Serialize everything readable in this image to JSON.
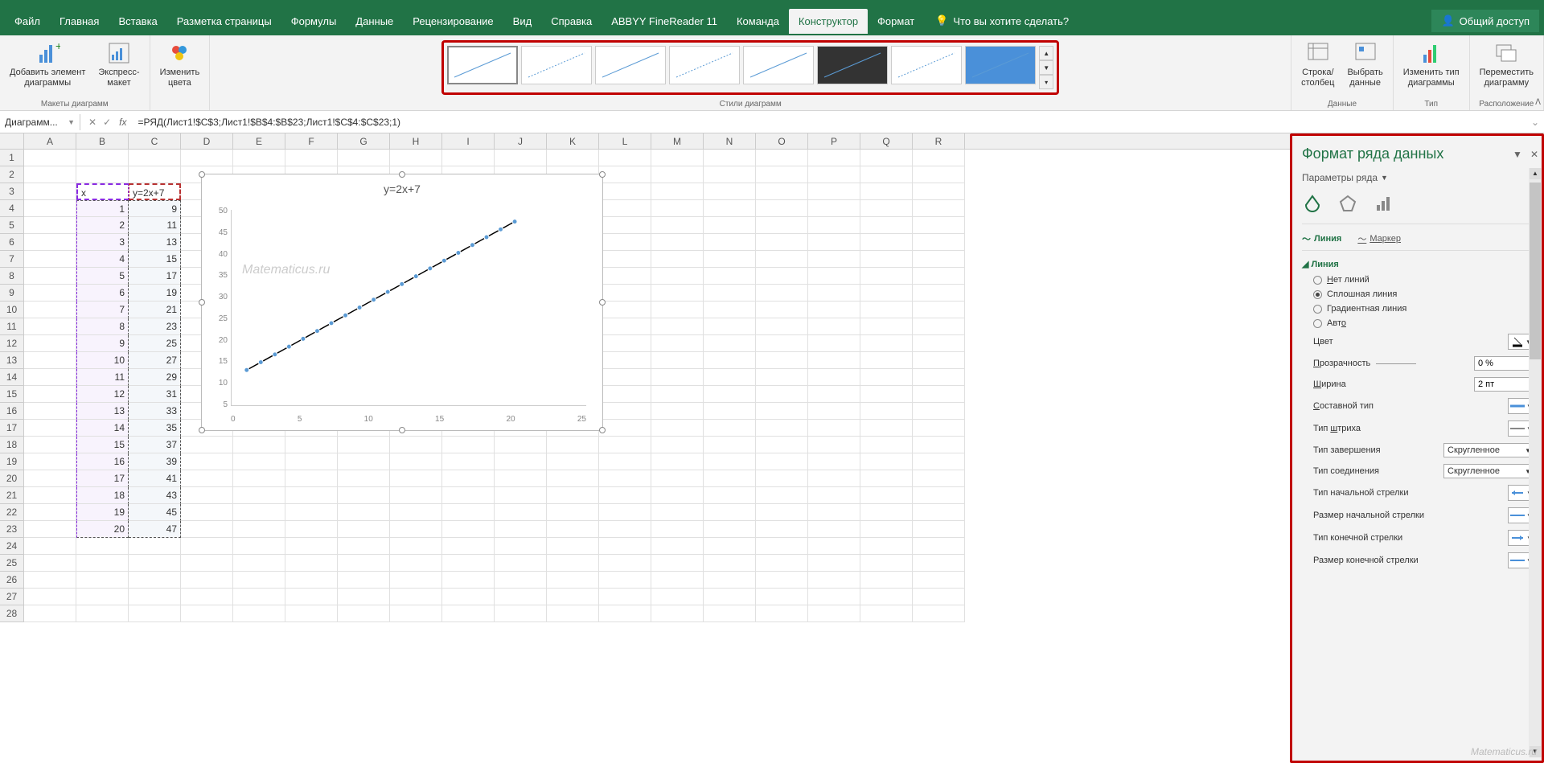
{
  "menu": [
    "Файл",
    "Главная",
    "Вставка",
    "Разметка страницы",
    "Формулы",
    "Данные",
    "Рецензирование",
    "Вид",
    "Справка",
    "ABBYY FineReader 11",
    "Команда",
    "Конструктор",
    "Формат"
  ],
  "active_menu": "Конструктор",
  "tell_me": "Что вы хотите сделать?",
  "share": "Общий доступ",
  "ribbon": {
    "add_element": "Добавить элемент\nдиаграммы",
    "quick_layout": "Экспресс-\nмакет",
    "group1": "Макеты диаграмм",
    "change_colors": "Изменить\nцвета",
    "group2": "Стили диаграмм",
    "switch_rc": "Строка/\nстолбец",
    "select_data": "Выбрать\nданные",
    "group3": "Данные",
    "change_type": "Изменить тип\nдиаграммы",
    "group4": "Тип",
    "move_chart": "Переместить\nдиаграмму",
    "group5": "Расположение"
  },
  "name_box": "Диаграмм...",
  "formula": "=РЯД(Лист1!$C$3;Лист1!$B$4:$B$23;Лист1!$C$4:$C$23;1)",
  "columns": [
    "A",
    "B",
    "C",
    "D",
    "E",
    "F",
    "G",
    "H",
    "I",
    "J",
    "K",
    "L",
    "M",
    "N",
    "O",
    "P",
    "Q",
    "R"
  ],
  "rows": [
    1,
    2,
    3,
    4,
    5,
    6,
    7,
    8,
    9,
    10,
    11,
    12,
    13,
    14,
    15,
    16,
    17,
    18,
    19,
    20,
    21,
    22,
    23,
    24,
    25,
    26,
    27,
    28
  ],
  "sheet": {
    "b3": "x",
    "c3": "y=2x+7",
    "data": [
      {
        "b": "1",
        "c": "9"
      },
      {
        "b": "2",
        "c": "11"
      },
      {
        "b": "3",
        "c": "13"
      },
      {
        "b": "4",
        "c": "15"
      },
      {
        "b": "5",
        "c": "17"
      },
      {
        "b": "6",
        "c": "19"
      },
      {
        "b": "7",
        "c": "21"
      },
      {
        "b": "8",
        "c": "23"
      },
      {
        "b": "9",
        "c": "25"
      },
      {
        "b": "10",
        "c": "27"
      },
      {
        "b": "11",
        "c": "29"
      },
      {
        "b": "12",
        "c": "31"
      },
      {
        "b": "13",
        "c": "33"
      },
      {
        "b": "14",
        "c": "35"
      },
      {
        "b": "15",
        "c": "37"
      },
      {
        "b": "16",
        "c": "39"
      },
      {
        "b": "17",
        "c": "41"
      },
      {
        "b": "18",
        "c": "43"
      },
      {
        "b": "19",
        "c": "45"
      },
      {
        "b": "20",
        "c": "47"
      }
    ]
  },
  "chart_data": {
    "type": "line",
    "title": "y=2x+7",
    "x": [
      1,
      2,
      3,
      4,
      5,
      6,
      7,
      8,
      9,
      10,
      11,
      12,
      13,
      14,
      15,
      16,
      17,
      18,
      19,
      20
    ],
    "y": [
      9,
      11,
      13,
      15,
      17,
      19,
      21,
      23,
      25,
      27,
      29,
      31,
      33,
      35,
      37,
      39,
      41,
      43,
      45,
      47
    ],
    "xlim": [
      0,
      25
    ],
    "ylim": [
      0,
      50
    ],
    "xticks": [
      0,
      5,
      10,
      15,
      20,
      25
    ],
    "yticks": [
      5,
      10,
      15,
      20,
      25,
      30,
      35,
      40,
      45,
      50
    ],
    "watermark": "Matematicus.ru"
  },
  "format_pane": {
    "title": "Формат ряда данных",
    "subtitle": "Параметры ряда",
    "tab_line": "Линия",
    "tab_marker": "Маркер",
    "section": "Линия",
    "radio_none": "Нет линий",
    "radio_solid": "Сплошная линия",
    "radio_gradient": "Градиентная линия",
    "radio_auto": "Авто",
    "radio_selected": "Сплошная линия",
    "color": "Цвет",
    "transparency": "Прозрачность",
    "transparency_val": "0 %",
    "width": "Ширина",
    "width_val": "2 пт",
    "compound": "Составной тип",
    "dash": "Тип штриха",
    "cap": "Тип завершения",
    "cap_val": "Скругленное",
    "join": "Тип соединения",
    "join_val": "Скругленное",
    "begin_arrow_type": "Тип начальной стрелки",
    "begin_arrow_size": "Размер начальной стрелки",
    "end_arrow_type": "Тип конечной стрелки",
    "end_arrow_size": "Размер конечной стрелки"
  },
  "watermark2": "Matematicus.ru"
}
